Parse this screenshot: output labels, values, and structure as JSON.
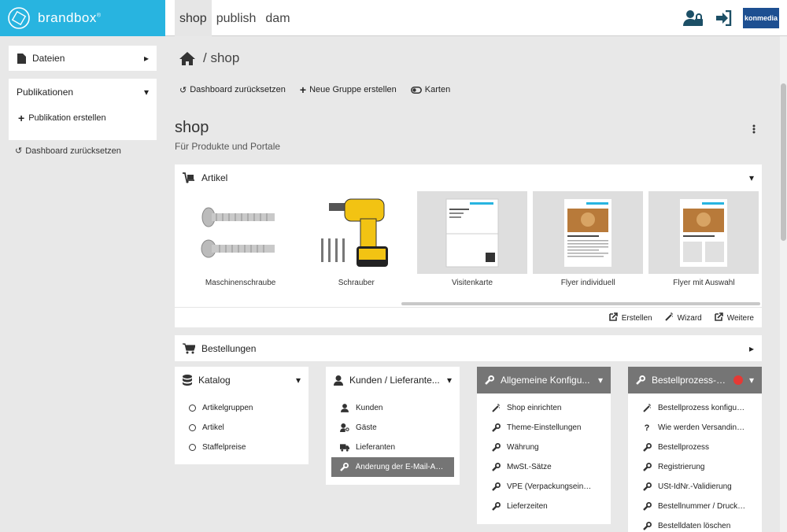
{
  "app": {
    "brand": "brandbox",
    "brand_mark": "®",
    "partner_logo": "konmedia"
  },
  "top_tabs": [
    {
      "label": "shop",
      "active": true
    },
    {
      "label": "publish",
      "active": false
    },
    {
      "label": "dam",
      "active": false
    }
  ],
  "sidebar": {
    "dateien": "Dateien",
    "publikationen": "Publikationen",
    "publikation_erstellen": "Publikation erstellen",
    "reset": "Dashboard zurücksetzen"
  },
  "breadcrumb": {
    "current": "/ shop"
  },
  "toolbar": {
    "reset": "Dashboard zurücksetzen",
    "new_group": "Neue Gruppe erstellen",
    "cards": "Karten"
  },
  "page": {
    "title": "shop",
    "subtitle": "Für Produkte und Portale"
  },
  "artikel": {
    "title": "Artikel",
    "items": [
      {
        "caption": "Maschinenschraube",
        "icon": "screw-image"
      },
      {
        "caption": "Schrauber",
        "icon": "drill-image"
      },
      {
        "caption": "Visitenkarte",
        "icon": "business-card-image"
      },
      {
        "caption": "Flyer individuell",
        "icon": "flyer-image"
      },
      {
        "caption": "Flyer mit Auswahl",
        "icon": "flyer-image"
      }
    ],
    "actions": {
      "create": "Erstellen",
      "wizard": "Wizard",
      "more": "Weitere"
    }
  },
  "bestellungen": {
    "title": "Bestellungen"
  },
  "katalog": {
    "title": "Katalog",
    "items": [
      "Artikelgruppen",
      "Artikel",
      "Staffelpreise"
    ]
  },
  "kunden": {
    "title": "Kunden / Lieferante...",
    "items": [
      {
        "label": "Kunden",
        "icon": "user-icon"
      },
      {
        "label": "Gäste",
        "icon": "user-key-icon"
      },
      {
        "label": "Lieferanten",
        "icon": "truck-icon"
      },
      {
        "label": "Änderung der E-Mail-Adr...",
        "icon": "wrench-icon",
        "highlight": true
      }
    ]
  },
  "konfig": {
    "title": "Allgemeine Konfigu...",
    "items": [
      {
        "label": "Shop einrichten",
        "icon": "magic-wand-icon"
      },
      {
        "label": "Theme-Einstellungen",
        "icon": "wrench-icon"
      },
      {
        "label": "Währung",
        "icon": "wrench-icon"
      },
      {
        "label": "MwSt.-Sätze",
        "icon": "wrench-icon"
      },
      {
        "label": "VPE (Verpackungseinhe...",
        "icon": "wrench-icon"
      },
      {
        "label": "Lieferzeiten",
        "icon": "wrench-icon"
      }
    ]
  },
  "bestellprozess": {
    "title": "Bestellprozess-K...",
    "items": [
      {
        "label": "Bestellprozess konfiguri...",
        "icon": "magic-wand-icon"
      },
      {
        "label": "Wie werden Versandinfo...",
        "icon": "question-icon"
      },
      {
        "label": "Bestellprozess",
        "icon": "wrench-icon"
      },
      {
        "label": "Registrierung",
        "icon": "wrench-icon"
      },
      {
        "label": "USt-IdNr.-Validierung",
        "icon": "wrench-icon"
      },
      {
        "label": "Bestellnummer / Druckd...",
        "icon": "wrench-icon"
      },
      {
        "label": "Bestelldaten löschen",
        "icon": "wrench-icon"
      }
    ]
  }
}
